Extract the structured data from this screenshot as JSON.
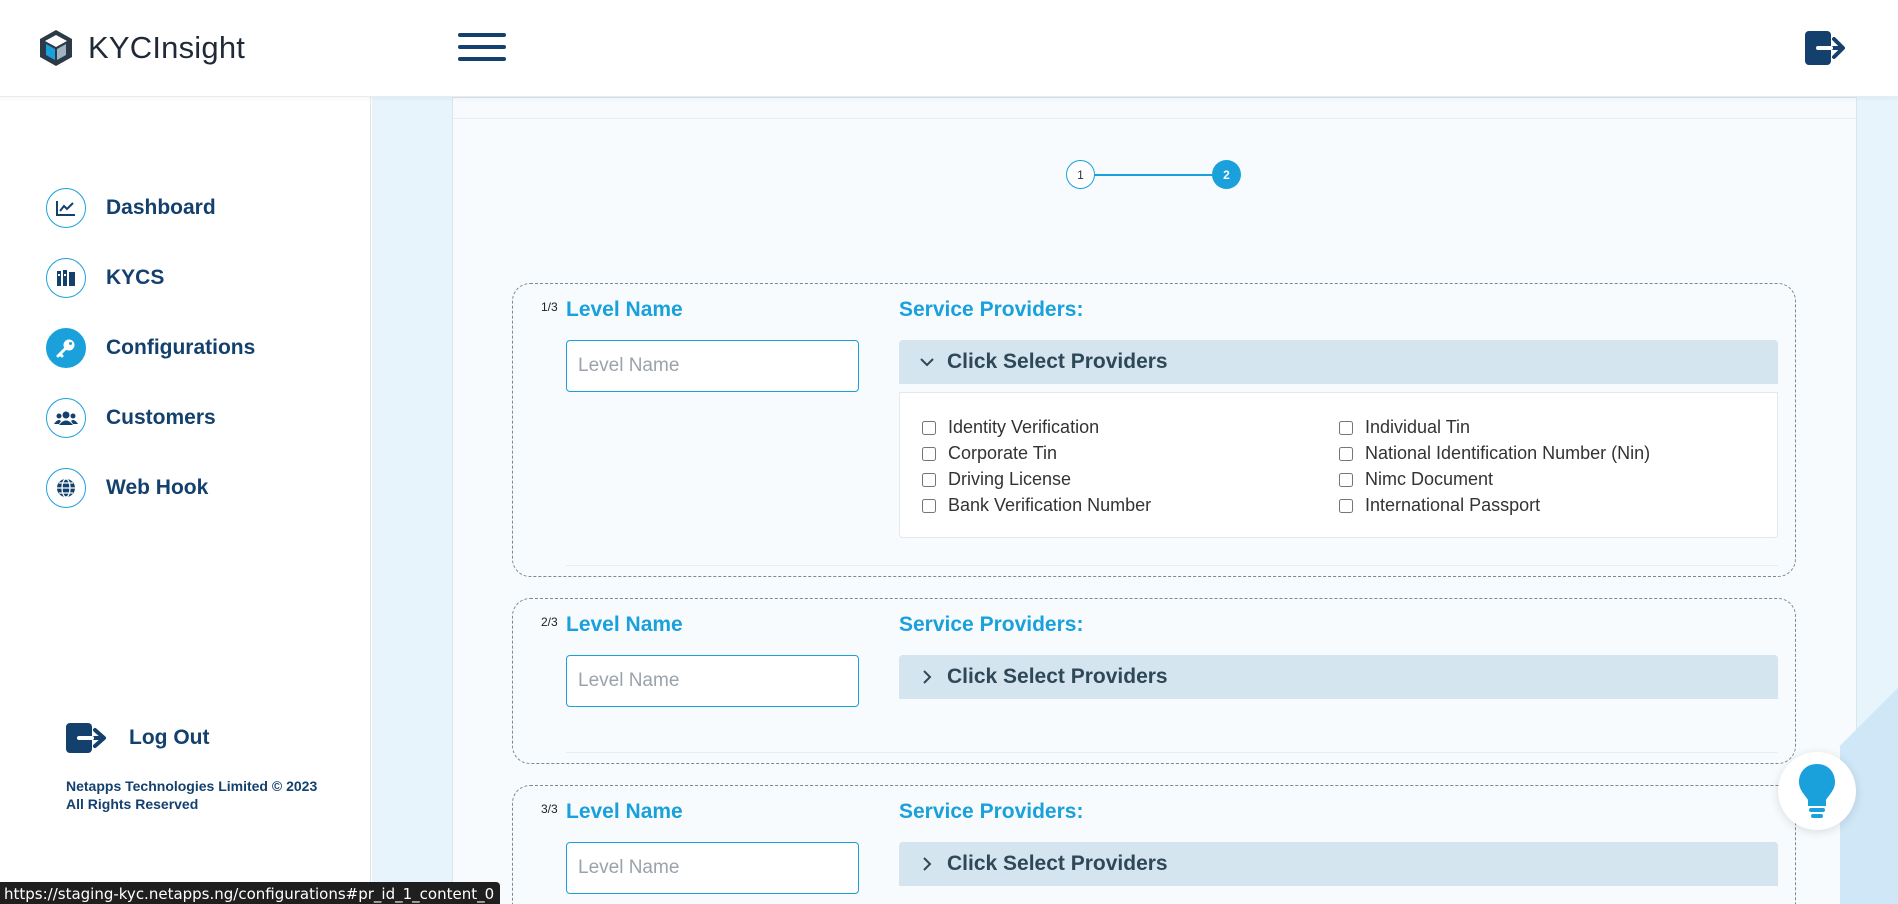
{
  "app": {
    "name": "KYCInsight"
  },
  "colors": {
    "accent": "#1aa1dc",
    "navy": "#14406e",
    "main_bg": "#e8f4fc"
  },
  "header": {
    "menu_icon": "hamburger-icon",
    "logout_icon": "logout-icon"
  },
  "sidebar": {
    "items": [
      {
        "label": "Dashboard",
        "icon": "chart-line-icon"
      },
      {
        "label": "KYCS",
        "icon": "documents-icon"
      },
      {
        "label": "Configurations",
        "icon": "key-icon",
        "active": true
      },
      {
        "label": "Customers",
        "icon": "users-icon"
      },
      {
        "label": "Web Hook",
        "icon": "globe-icon"
      }
    ],
    "logout_label": "Log Out",
    "copyright": "Netapps Technologies Limited © 2023 All Rights Reserved"
  },
  "stepper": {
    "steps": [
      "1",
      "2"
    ],
    "current": 2
  },
  "levels": [
    {
      "num": "1/3",
      "title": "Level Name",
      "input_placeholder": "Level Name",
      "input_value": "",
      "providers_title": "Service Providers:",
      "accordion_label": "Click Select Providers",
      "expanded": true,
      "options": [
        {
          "label": "Identity Verification",
          "checked": false
        },
        {
          "label": "Individual Tin",
          "checked": false
        },
        {
          "label": "Corporate Tin",
          "checked": false
        },
        {
          "label": "National Identification Number (Nin)",
          "checked": false
        },
        {
          "label": "Driving License",
          "checked": false
        },
        {
          "label": "Nimc Document",
          "checked": false
        },
        {
          "label": "Bank Verification Number",
          "checked": false
        },
        {
          "label": "International Passport",
          "checked": false
        }
      ]
    },
    {
      "num": "2/3",
      "title": "Level Name",
      "input_placeholder": "Level Name",
      "input_value": "",
      "providers_title": "Service Providers:",
      "accordion_label": "Click Select Providers",
      "expanded": false
    },
    {
      "num": "3/3",
      "title": "Level Name",
      "input_placeholder": "Level Name",
      "input_value": "",
      "providers_title": "Service Providers:",
      "accordion_label": "Click Select Providers",
      "expanded": false
    }
  ],
  "status_bar": {
    "url": "https://staging-kyc.netapps.ng/configurations#pr_id_1_content_0"
  },
  "help_button": {
    "icon": "lightbulb-icon"
  }
}
